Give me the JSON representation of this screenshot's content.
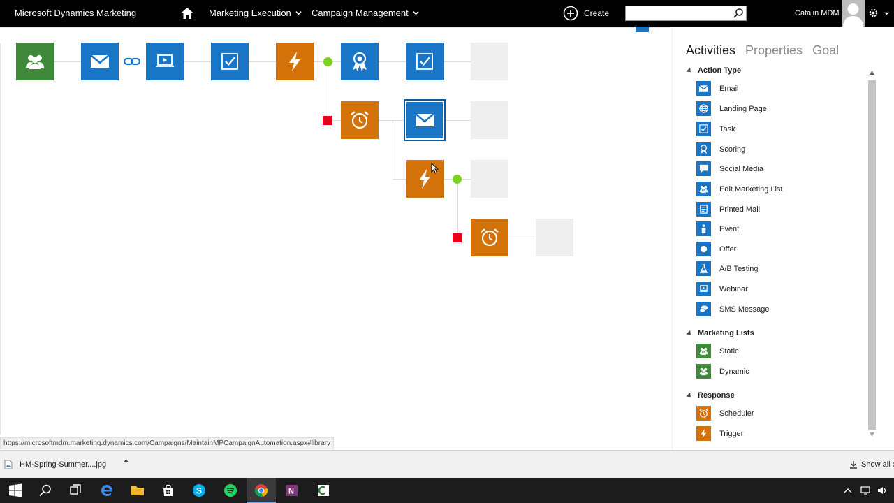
{
  "header": {
    "brand": "Microsoft Dynamics Marketing",
    "nav": [
      {
        "label": "Marketing Execution"
      },
      {
        "label": "Campaign Management"
      }
    ],
    "create_label": "Create",
    "search_placeholder": "",
    "user_name": "Catalin MDM"
  },
  "canvas": {
    "status_url": "https://microsoftmdm.marketing.dynamics.com/Campaigns/MaintainMPCampaignAutomation.aspx#library"
  },
  "panel": {
    "tabs": [
      {
        "label": "Activities",
        "active": true
      },
      {
        "label": "Properties",
        "active": false
      },
      {
        "label": "Goal",
        "active": false
      }
    ],
    "sections": {
      "action_type": {
        "title": "Action Type",
        "items": [
          {
            "label": "Email",
            "icon": "email-icon"
          },
          {
            "label": "Landing Page",
            "icon": "globe-icon"
          },
          {
            "label": "Task",
            "icon": "task-check-icon"
          },
          {
            "label": "Scoring",
            "icon": "ribbon-icon"
          },
          {
            "label": "Social Media",
            "icon": "speech-bubble-icon"
          },
          {
            "label": "Edit Marketing List",
            "icon": "people-icon"
          },
          {
            "label": "Printed Mail",
            "icon": "printed-page-icon"
          },
          {
            "label": "Event",
            "icon": "person-icon"
          },
          {
            "label": "Offer",
            "icon": "circle-icon"
          },
          {
            "label": "A/B Testing",
            "icon": "flask-icon"
          },
          {
            "label": "Webinar",
            "icon": "presentation-icon"
          },
          {
            "label": "SMS Message",
            "icon": "chat-bubbles-icon"
          }
        ]
      },
      "marketing_lists": {
        "title": "Marketing Lists",
        "items": [
          {
            "label": "Static",
            "icon": "people-icon"
          },
          {
            "label": "Dynamic",
            "icon": "people-icon"
          }
        ]
      },
      "response": {
        "title": "Response",
        "items": [
          {
            "label": "Scheduler",
            "icon": "alarm-clock-icon"
          },
          {
            "label": "Trigger",
            "icon": "lightning-icon"
          }
        ]
      }
    }
  },
  "downloads": {
    "file_name": "HM-Spring-Summer....jpg",
    "show_all": "Show all d"
  },
  "colors": {
    "green_tile": "#3f8a3a",
    "blue_tile": "#1976c6",
    "orange_tile": "#d4720a",
    "connector_green": "#7ed321",
    "connector_red": "#e8001c"
  }
}
